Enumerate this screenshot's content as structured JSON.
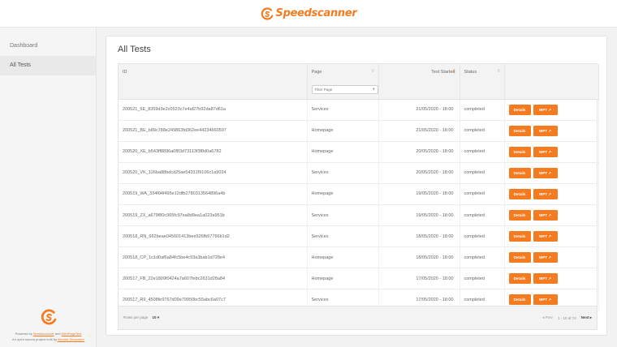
{
  "brand": {
    "name": "Speedscanner",
    "accent": "#f47b20"
  },
  "sidebar": {
    "items": [
      {
        "label": "Dashboard",
        "active": false
      },
      {
        "label": "All Tests",
        "active": true
      }
    ],
    "footer": {
      "powered_prefix": "Powered by ",
      "speedscanner_link": "Speedscanner",
      "and": " and ",
      "webpagetest_link": "WebPageTest",
      "opensource_prefix": "An open source project built by ",
      "altmetric_link": "Altmark Shepmere"
    }
  },
  "main": {
    "title": "All Tests",
    "columns": {
      "id": "ID",
      "page": "Page",
      "test_started": "Test Started",
      "status": "Status"
    },
    "filter": {
      "placeholder": "Filter Page"
    },
    "action_labels": {
      "details": "Details",
      "wpt": "WPT"
    },
    "rows": [
      {
        "id": "200521_6E_8359d3e2c0523c7e4af27b92da87d61a",
        "page": "Services",
        "started": "21/05/2020 - 18:00",
        "status": "completed"
      },
      {
        "id": "200521_BE_b89c788e249863fd362ee44234660597",
        "page": "Homepage",
        "started": "21/05/2020 - 18:00",
        "status": "completed"
      },
      {
        "id": "200520_XE_b543ff8896a0f83d73113f3f8d0a6782",
        "page": "Homepage",
        "started": "20/05/2020 - 18:00",
        "status": "completed"
      },
      {
        "id": "200520_VK_126ba88bdcd25ae54331f9106c1a9034",
        "page": "Services",
        "started": "20/05/2020 - 18:00",
        "status": "completed"
      },
      {
        "id": "200519_WA_334f04f495e12dfb2780313564896a4b",
        "page": "Homepage",
        "started": "19/05/2020 - 18:00",
        "status": "completed"
      },
      {
        "id": "200519_ZX_a679f80c965fc97ea8d9ea1a023a951b",
        "page": "Services",
        "started": "19/05/2020 - 18:00",
        "status": "completed"
      },
      {
        "id": "200518_RN_662beae045601413bee926fb57766b1d2",
        "page": "Services",
        "started": "18/05/2020 - 18:00",
        "status": "completed"
      },
      {
        "id": "200518_CP_1c1d0af6a84fc5be4c93a3bab1d728e4",
        "page": "Homepage",
        "started": "18/05/2020 - 18:00",
        "status": "completed"
      },
      {
        "id": "200517_FB_22e1809f0424a7a607febc2631d28a84",
        "page": "Homepage",
        "started": "17/05/2020 - 18:00",
        "status": "completed"
      },
      {
        "id": "200517_R9_4508fe9767d09e79950bc55abc6a07c7",
        "page": "Services",
        "started": "17/05/2020 - 18:00",
        "status": "completed"
      }
    ],
    "pagination": {
      "rows_per_page_label": "Rows per page",
      "rows_per_page_value": "10",
      "prev": "Prev",
      "range": "1 - 10 of 74",
      "next": "Next"
    }
  }
}
